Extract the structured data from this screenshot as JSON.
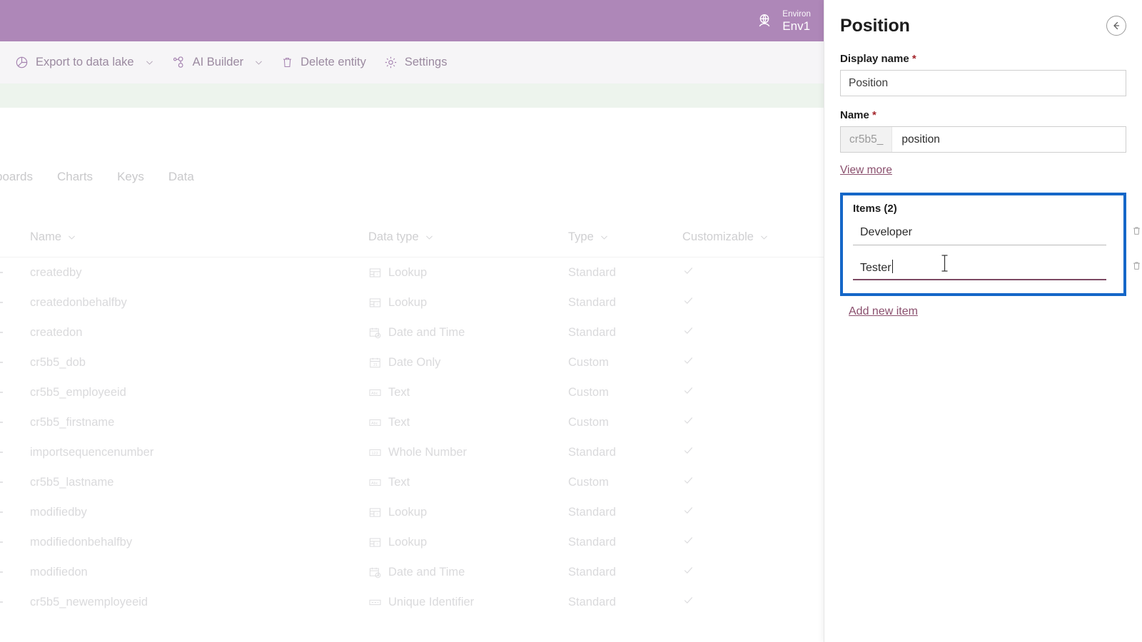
{
  "topbar": {
    "env_icon": "globe-environment-icon",
    "env_label": "Environ",
    "env_name": "Env1"
  },
  "commandbar": {
    "items": [
      {
        "label": "Export to data lake",
        "icon": "data-lake-icon",
        "has_caret": true
      },
      {
        "label": "AI Builder",
        "icon": "ai-builder-icon",
        "has_caret": true
      },
      {
        "label": "Delete entity",
        "icon": "trash-icon",
        "has_caret": false
      },
      {
        "label": "Settings",
        "icon": "gear-icon",
        "has_caret": false
      }
    ]
  },
  "tabs": [
    {
      "label": "boards"
    },
    {
      "label": "Charts"
    },
    {
      "label": "Keys"
    },
    {
      "label": "Data"
    }
  ],
  "grid": {
    "columns": [
      {
        "label": "Name"
      },
      {
        "label": "Data type"
      },
      {
        "label": "Type"
      },
      {
        "label": "Customizable"
      }
    ],
    "rows": [
      {
        "name": "createdby",
        "data_type": "Lookup",
        "icon": "lookup-icon",
        "type": "Standard",
        "customizable": true
      },
      {
        "name": "createdonbehalfby",
        "data_type": "Lookup",
        "icon": "lookup-icon",
        "type": "Standard",
        "customizable": true
      },
      {
        "name": "createdon",
        "data_type": "Date and Time",
        "icon": "date-time-icon",
        "type": "Standard",
        "customizable": true
      },
      {
        "name": "cr5b5_dob",
        "data_type": "Date Only",
        "icon": "date-only-icon",
        "type": "Custom",
        "customizable": true
      },
      {
        "name": "cr5b5_employeeid",
        "data_type": "Text",
        "icon": "text-icon",
        "type": "Custom",
        "customizable": true
      },
      {
        "name": "cr5b5_firstname",
        "data_type": "Text",
        "icon": "text-icon",
        "type": "Custom",
        "customizable": true
      },
      {
        "name": "importsequencenumber",
        "data_type": "Whole Number",
        "icon": "whole-number-icon",
        "type": "Standard",
        "customizable": true
      },
      {
        "name": "cr5b5_lastname",
        "data_type": "Text",
        "icon": "text-icon",
        "type": "Custom",
        "customizable": true
      },
      {
        "name": "modifiedby",
        "data_type": "Lookup",
        "icon": "lookup-icon",
        "type": "Standard",
        "customizable": true
      },
      {
        "name": "modifiedonbehalfby",
        "data_type": "Lookup",
        "icon": "lookup-icon",
        "type": "Standard",
        "customizable": true
      },
      {
        "name": "modifiedon",
        "data_type": "Date and Time",
        "icon": "date-time-icon",
        "type": "Standard",
        "customizable": true
      },
      {
        "name": "cr5b5_newemployeeid",
        "data_type": "Unique Identifier",
        "icon": "unique-identifier-icon",
        "type": "Standard",
        "customizable": true
      }
    ]
  },
  "panel": {
    "title": "Position",
    "back_icon": "back-arrow-icon",
    "display_name_label": "Display name",
    "display_name_value": "Position",
    "name_label": "Name",
    "name_prefix": "cr5b5_",
    "name_value": "position",
    "view_more_label": "View more",
    "required_marker": "*",
    "items_title": "Items (2)",
    "items": [
      {
        "value": "Developer",
        "focused": false
      },
      {
        "value": "Tester",
        "focused": true
      }
    ],
    "add_new_item_label": "Add new item"
  },
  "colors": {
    "brand_purple": "#ae87b8",
    "notification_green": "#edf4ed",
    "focus_blue": "#1567c8",
    "link_maroon": "#8a4f6d",
    "required_red": "#a4262c"
  }
}
